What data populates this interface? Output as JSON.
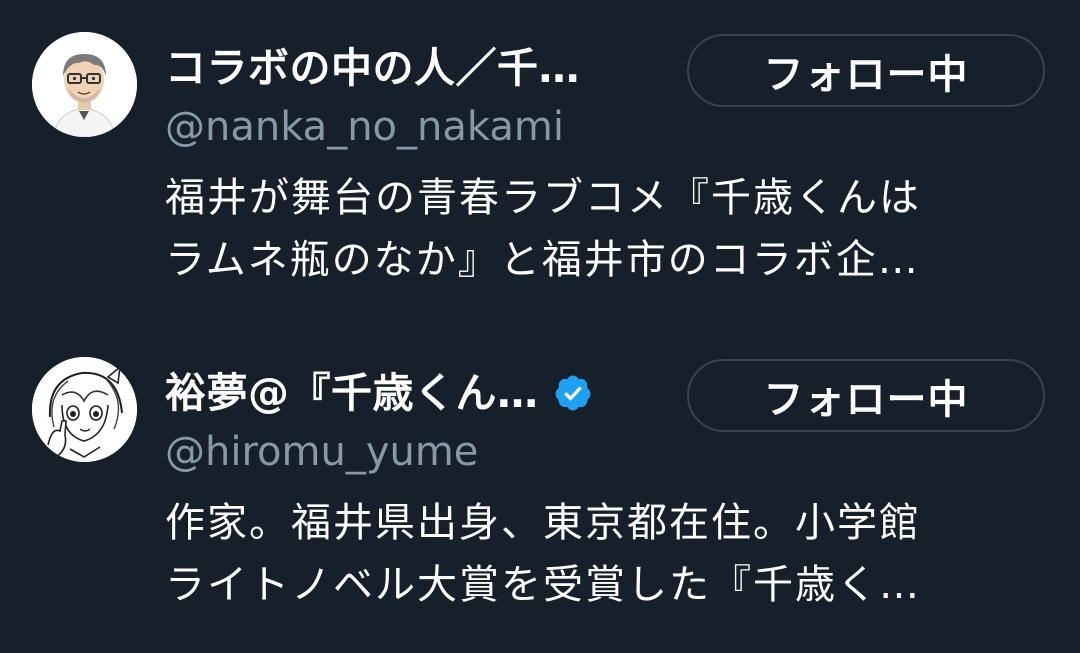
{
  "accounts": [
    {
      "display_name": "コラボの中の人／千…",
      "handle": "@nanka_no_nakami",
      "verified": false,
      "follow_label": "フォロー中",
      "bio_lines": [
        "福井が舞台の青春ラブコメ『千歳くんは",
        "ラムネ瓶のなか』と福井市のコラボ企…"
      ],
      "avatar_icon": "cartoon-man-with-glasses-avatar"
    },
    {
      "display_name": "裕夢@『千歳くん…",
      "handle": "@hiromu_yume",
      "verified": true,
      "follow_label": "フォロー中",
      "bio_lines": [
        "作家。福井県出身、東京都在住。小学館",
        "ライトノベル大賞を受賞した『千歳く…"
      ],
      "avatar_icon": "anime-girl-sketch-avatar"
    }
  ],
  "colors": {
    "background": "#15202b",
    "primary_text": "#ffffff",
    "secondary_text": "#8899a6",
    "button_border": "#38444d",
    "verified_blue": "#1da1f2"
  }
}
